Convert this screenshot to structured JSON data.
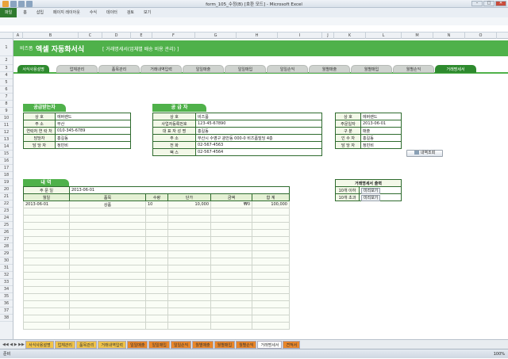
{
  "window": {
    "title": "form_105_수정(B) [호환 모드] - Microsoft Excel",
    "min": "–",
    "max": "□",
    "close": "✕"
  },
  "ribbon": {
    "tabs": [
      "파일",
      "홈",
      "삽입",
      "페이지 레이아웃",
      "수식",
      "데이터",
      "검토",
      "보기"
    ]
  },
  "columns": [
    "A",
    "B",
    "C",
    "D",
    "E",
    "F",
    "G",
    "H",
    "I",
    "J",
    "K",
    "L",
    "M",
    "N",
    "O"
  ],
  "rows": [
    "1",
    "2",
    "3",
    "4",
    "5",
    "6",
    "7",
    "8",
    "9",
    "10",
    "11",
    "12",
    "13",
    "14",
    "15",
    "16",
    "17",
    "18",
    "19",
    "20",
    "21",
    "22",
    "23",
    "24",
    "25",
    "26",
    "27",
    "28",
    "29",
    "30",
    "31",
    "32",
    "33",
    "34",
    "35",
    "36",
    "37",
    "38"
  ],
  "banner": {
    "brand": "비즈폼",
    "title": "엑셀 자동화서식",
    "subtitle": "[ 거래명세서(업체별 배송 비용 관리) ]"
  },
  "nav": [
    "서식사용설명",
    "업체관리",
    "품목관리",
    "거래내역입력",
    "일일매출",
    "일일매입",
    "일일손익",
    "월별매출",
    "월별매입",
    "월별손익",
    "거래명세서"
  ],
  "receiver": {
    "heading": "공급받는자",
    "fields": [
      {
        "label": "상 호",
        "value": "에버랜드"
      },
      {
        "label": "주 소",
        "value": "부산"
      },
      {
        "label": "연락처 연 락 처",
        "value": "010-345-6789"
      },
      {
        "label": "담당자",
        "value": "홍길동"
      },
      {
        "label": "담 당 자",
        "value": "정빈비"
      }
    ]
  },
  "supplier": {
    "heading": "공 급 자",
    "fields": [
      {
        "label": "상 호",
        "value": "비즈폼"
      },
      {
        "label": "사업자등록번호",
        "value": "123-45-67890"
      },
      {
        "label": "대 표 자 성 명",
        "value": "홍길동"
      },
      {
        "label": "주 소",
        "value": "부산시 수영구 광안동 000-0 비즈폼빌딩 4층"
      },
      {
        "label": "전 화",
        "value": "02-567-4563"
      },
      {
        "label": "팩 스",
        "value": "02-567-4564"
      }
    ]
  },
  "lookup": {
    "fields": [
      {
        "label": "상 호",
        "value": "에버랜드"
      },
      {
        "label": "주문일자",
        "value": "2013-06-01"
      },
      {
        "label": "구 분",
        "value": "매출"
      },
      {
        "label": "인 수 자",
        "value": "홍길동"
      },
      {
        "label": "담 당 자",
        "value": "정빈비"
      }
    ],
    "button": "내역조회"
  },
  "print_panel": {
    "title": "거래명세서 출력",
    "rows": [
      {
        "label": "10개 이하",
        "button": "미리보기"
      },
      {
        "label": "10개 초과",
        "button": "미리보기"
      }
    ]
  },
  "ledger": {
    "heading": "내 역",
    "summary_label": "주 문 일",
    "summary_value": "2013-06-01",
    "headers": [
      "월일",
      "품목",
      "수량",
      "단가",
      "금액",
      "합 계"
    ],
    "rows": [
      {
        "date": "2013-06-01",
        "item": "상품",
        "qty": "10",
        "price": "10,000",
        "amount": "₩0",
        "total": "100,000"
      }
    ],
    "empty_rows": 17
  },
  "sheet_tabs": [
    "서식사용설명",
    "업체관리",
    "품목관리",
    "거래내역입력",
    "일일매출",
    "일일매입",
    "일일손익",
    "월별매출",
    "월별매입",
    "월별손익",
    "거래명세서",
    "견적서"
  ],
  "status": {
    "left": "준비",
    "zoom": "100%"
  }
}
